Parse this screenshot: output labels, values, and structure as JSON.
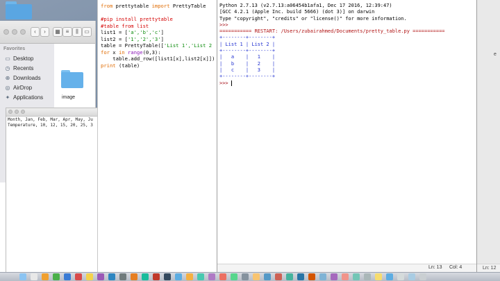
{
  "colors": {
    "keyword": "#e06b00",
    "comment": "#d40000",
    "string": "#0a8a0a",
    "builtin": "#8b19b8",
    "restart": "#b01212",
    "folder": "#5aa6e2"
  },
  "finder": {
    "favorites_header": "Favorites",
    "items": [
      {
        "label": "Desktop",
        "icon": "desktop-icon"
      },
      {
        "label": "Recents",
        "icon": "clock-icon"
      },
      {
        "label": "Downloads",
        "icon": "download-icon"
      },
      {
        "label": "AirDrop",
        "icon": "airdrop-icon"
      },
      {
        "label": "Applications",
        "icon": "apps-icon"
      }
    ],
    "file_label": "image"
  },
  "textedit": {
    "line1": "Month, Jan, Feb, Mar, Apr, May, Ju",
    "line2": "Temperature, 10, 12, 15, 20, 25, 3"
  },
  "editor": {
    "l1a": "from",
    "l1b": " prettytable ",
    "l1c": "import",
    "l1d": " PrettyTable",
    "l3": "#pip install prettytable",
    "l4": "#table from list",
    "l5a": "list1 = [",
    "l5b": "'a','b','c'",
    "l5c": "]",
    "l6a": "list2 = [",
    "l6b": "'1','2','3'",
    "l6c": "]",
    "l7a": "table = PrettyTable([",
    "l7b": "'List 1','List 2",
    "l8a": "for",
    "l8b": " x ",
    "l8c": "in",
    "l8d": " ",
    "l8e": "range",
    "l8f": "(0,3):",
    "l9": "    table.add_row([list1[x],list2[x]])",
    "l10a": "print",
    "l10b": " (table)"
  },
  "shell": {
    "line1": "Python 2.7.13 (v2.7.13:a06454b1afa1, Dec 17 2016, 12:39:47)",
    "line2": "[GCC 4.2.1 (Apple Inc. build 5666) (dot 3)] on darwin",
    "line3": "Type \"copyright\", \"credits\" or \"license()\" for more information.",
    "line4": ">>> ",
    "line5": "=========== RESTART: /Users/zubairahmed/Documents/pretty_table.py ===========",
    "line6": "+--------+--------+",
    "line7": "| List 1 | List 2 |",
    "line8": "+--------+--------+",
    "line9": "|   a    |   1    |",
    "line10": "|   b    |   2    |",
    "line11": "|   c    |   3    |",
    "line12": "+--------+--------+",
    "prompt": ">>> ",
    "status_ln": "Ln: 13",
    "status_col": "Col: 4"
  },
  "right_strip": {
    "label_a": "Ln: 12",
    "label_b": "e"
  }
}
